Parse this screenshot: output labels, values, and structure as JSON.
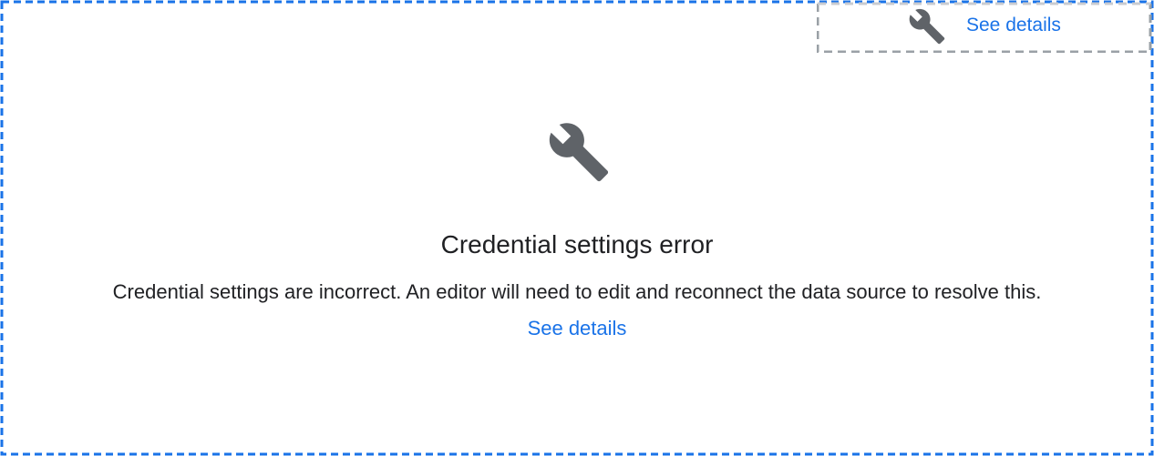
{
  "corner_tab": {
    "icon": "wrench-icon",
    "link_label": "See details"
  },
  "error": {
    "icon": "wrench-icon",
    "title": "Credential settings error",
    "message": "Credential settings are incorrect. An editor will need to edit and reconnect the data source to resolve this.",
    "details_label": "See details"
  },
  "colors": {
    "outer_border": "#1a73e8",
    "tab_border": "#9aa0a6",
    "icon": "#5f6368",
    "link": "#1a73e8",
    "text": "#202124"
  }
}
